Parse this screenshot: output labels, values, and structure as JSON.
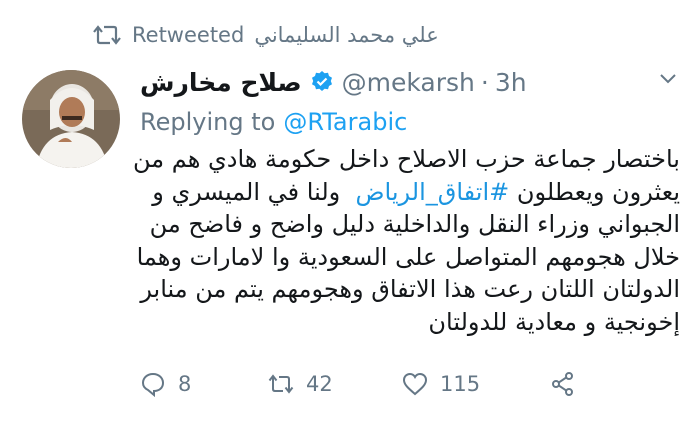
{
  "retweet": {
    "label": "Retweeted",
    "by": "علي محمد السليماني"
  },
  "author": {
    "name": "صلاح مخارش",
    "handle": "@mekarsh",
    "separator": "·",
    "time": "3h",
    "verified": true
  },
  "reply": {
    "prefix": "Replying to",
    "to": "@RTarabic"
  },
  "tweet": {
    "lines": [
      "باختصار جماعة حزب الاصلاح داخل حكومة هادي هم من",
      "يعثرون ويعطلون",
      "ولنا في الميسري و",
      "الجبواني وزراء النقل والداخلية دليل واضح و فاضح من",
      "خلال هجومهم المتواصل على السعودية وا لامارات وهما",
      "الدولتان اللتان رعت هذا الاتفاق وهجومهم يتم من منابر",
      "إخونجية و معادية للدولتان"
    ],
    "hashtag": "#اتفاق_الرياض"
  },
  "actions": {
    "replies": "8",
    "retweets": "42",
    "likes": "115"
  },
  "icons": {
    "retweet": "retweet-icon",
    "verified": "verified-badge-icon",
    "chevron": "chevron-down-icon",
    "reply": "reply-icon",
    "like": "heart-icon",
    "share": "share-icon"
  },
  "colors": {
    "link": "#1da1f2",
    "muted": "#657786",
    "text": "#14171a"
  }
}
